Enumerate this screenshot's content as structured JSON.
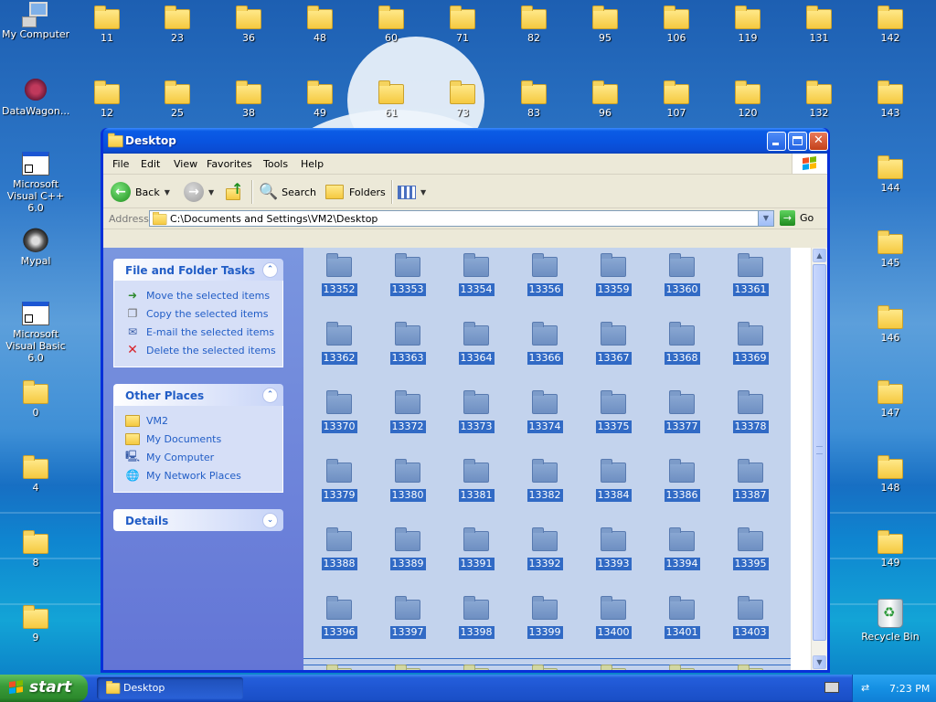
{
  "desktop": {
    "icons_left": [
      {
        "label": "My Computer",
        "kind": "computer"
      },
      {
        "label": "DataWagon...",
        "kind": "datawagon"
      },
      {
        "label": "Microsoft Visual C++ 6.0",
        "kind": "app"
      },
      {
        "label": "Mypal",
        "kind": "mypal"
      },
      {
        "label": "Microsoft Visual Basic 6.0",
        "kind": "app"
      },
      {
        "label": "0",
        "kind": "folder"
      },
      {
        "label": "4",
        "kind": "folder"
      },
      {
        "label": "8",
        "kind": "folder"
      },
      {
        "label": "9",
        "kind": "folder"
      }
    ],
    "folders_row1": [
      "11",
      "23",
      "36",
      "48",
      "60",
      "71",
      "82",
      "95",
      "106",
      "119",
      "131",
      "142"
    ],
    "folders_row2": [
      "12",
      "25",
      "38",
      "49",
      "61",
      "73",
      "83",
      "96",
      "107",
      "120",
      "132",
      "143"
    ],
    "folders_right": [
      "144",
      "145",
      "146",
      "147",
      "148",
      "149"
    ],
    "recycle_bin": "Recycle Bin"
  },
  "window": {
    "title": "Desktop",
    "menu": [
      "File",
      "Edit",
      "View",
      "Favorites",
      "Tools",
      "Help"
    ],
    "toolbar": {
      "back": "Back",
      "search": "Search",
      "folders": "Folders"
    },
    "address": {
      "label": "Address",
      "path": "C:\\Documents and Settings\\VM2\\Desktop",
      "go": "Go"
    },
    "tasks": {
      "file_folder_tasks": {
        "title": "File and Folder Tasks",
        "items": [
          "Move the selected items",
          "Copy the selected items",
          "E-mail the selected items",
          "Delete the selected items"
        ]
      },
      "other_places": {
        "title": "Other Places",
        "items": [
          "VM2",
          "My Documents",
          "My Computer",
          "My Network Places"
        ]
      },
      "details": {
        "title": "Details"
      }
    },
    "files": [
      [
        "13352",
        "13353",
        "13354",
        "13356",
        "13359",
        "13360",
        "13361"
      ],
      [
        "13362",
        "13363",
        "13364",
        "13366",
        "13367",
        "13368",
        "13369"
      ],
      [
        "13370",
        "13372",
        "13373",
        "13374",
        "13375",
        "13377",
        "13378"
      ],
      [
        "13379",
        "13380",
        "13381",
        "13382",
        "13384",
        "13386",
        "13387"
      ],
      [
        "13388",
        "13389",
        "13391",
        "13392",
        "13393",
        "13394",
        "13395"
      ],
      [
        "13396",
        "13397",
        "13398",
        "13399",
        "13400",
        "13401",
        "13403"
      ]
    ],
    "partial_row_count": 7
  },
  "taskbar": {
    "start": "start",
    "task": "Desktop",
    "clock": "7:23 PM"
  },
  "colors": {
    "selection": "#316ac5",
    "title_blue": "#0954e0",
    "task_pane": "#6375d6",
    "start_green": "#3a9b3a"
  }
}
